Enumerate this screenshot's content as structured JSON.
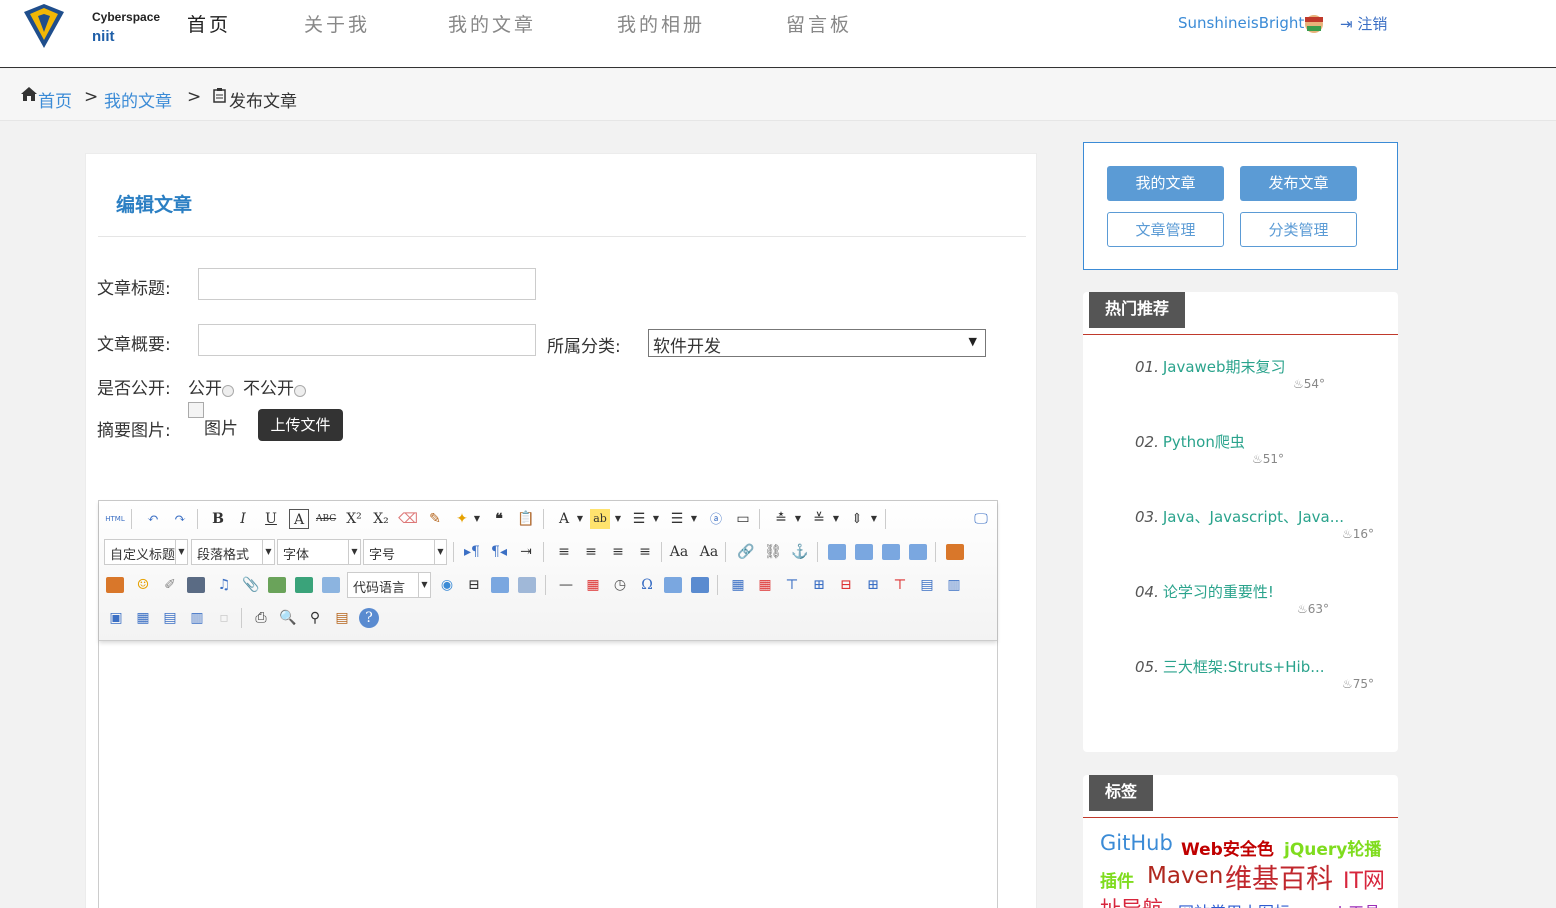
{
  "header": {
    "logo_line1": "Cyberspace",
    "logo_line2": "niit",
    "nav": [
      "首页",
      "关于我",
      "我的文章",
      "我的相册",
      "留言板"
    ],
    "username": "SunshineisBright",
    "logout": "注销"
  },
  "breadcrumb": {
    "home": "首页",
    "sep": ">",
    "articles": "我的文章",
    "current": "发布文章"
  },
  "form": {
    "title": "编辑文章",
    "title_label": "文章标题:",
    "title_value": "",
    "summary_label": "文章概要:",
    "summary_value": "",
    "category_label": "所属分类:",
    "category_value": "软件开发",
    "public_label": "是否公开:",
    "public_option": "公开",
    "private_option": "不公开",
    "image_label": "摘要图片:",
    "image_alt": "图片",
    "upload_button": "上传文件"
  },
  "editor": {
    "combo_custom_title": "自定义标题",
    "combo_paragraph": "段落格式",
    "combo_font": "字体",
    "combo_size": "字号",
    "combo_code": "代码语言"
  },
  "sidebar": {
    "btn_my_articles": "我的文章",
    "btn_publish": "发布文章",
    "btn_manage": "文章管理",
    "btn_category": "分类管理",
    "hot_title": "热门推荐",
    "hot": [
      {
        "num": "01.",
        "title": "Javaweb期末复习",
        "heat": "54°"
      },
      {
        "num": "02.",
        "title": "Python爬虫",
        "heat": "51°"
      },
      {
        "num": "03.",
        "title": "Java、Javascript、Java...",
        "heat": "16°"
      },
      {
        "num": "04.",
        "title": "论学习的重要性!",
        "heat": "63°"
      },
      {
        "num": "05.",
        "title": "三大框架:Struts+Hib...",
        "heat": "75°"
      }
    ],
    "tags_title": "标签",
    "tags": [
      {
        "text": "GitHub",
        "color": "#3b8bd6"
      },
      {
        "text": "Web安全色",
        "color": "#c00000"
      },
      {
        "text": "jQuery轮播",
        "color": "#7fdc1e"
      },
      {
        "text": "插件",
        "color": "#7fdc1e"
      },
      {
        "text": "Maven",
        "color": "#b0271e"
      },
      {
        "text": "维基百科",
        "color": "#c0272d"
      },
      {
        "text": "IT网",
        "color": "#d7263d"
      },
      {
        "text": "址导航",
        "color": "#d7263d"
      },
      {
        "text": "网站常用小图标",
        "color": "#2d5bd1"
      },
      {
        "text": "web工具",
        "color": "#9b2bb5"
      }
    ]
  },
  "colors": {
    "accent": "#3b8bd6",
    "title_blue": "#2b7fc3",
    "hot_green": "#2aa38c",
    "section_line": "#c0392b"
  }
}
